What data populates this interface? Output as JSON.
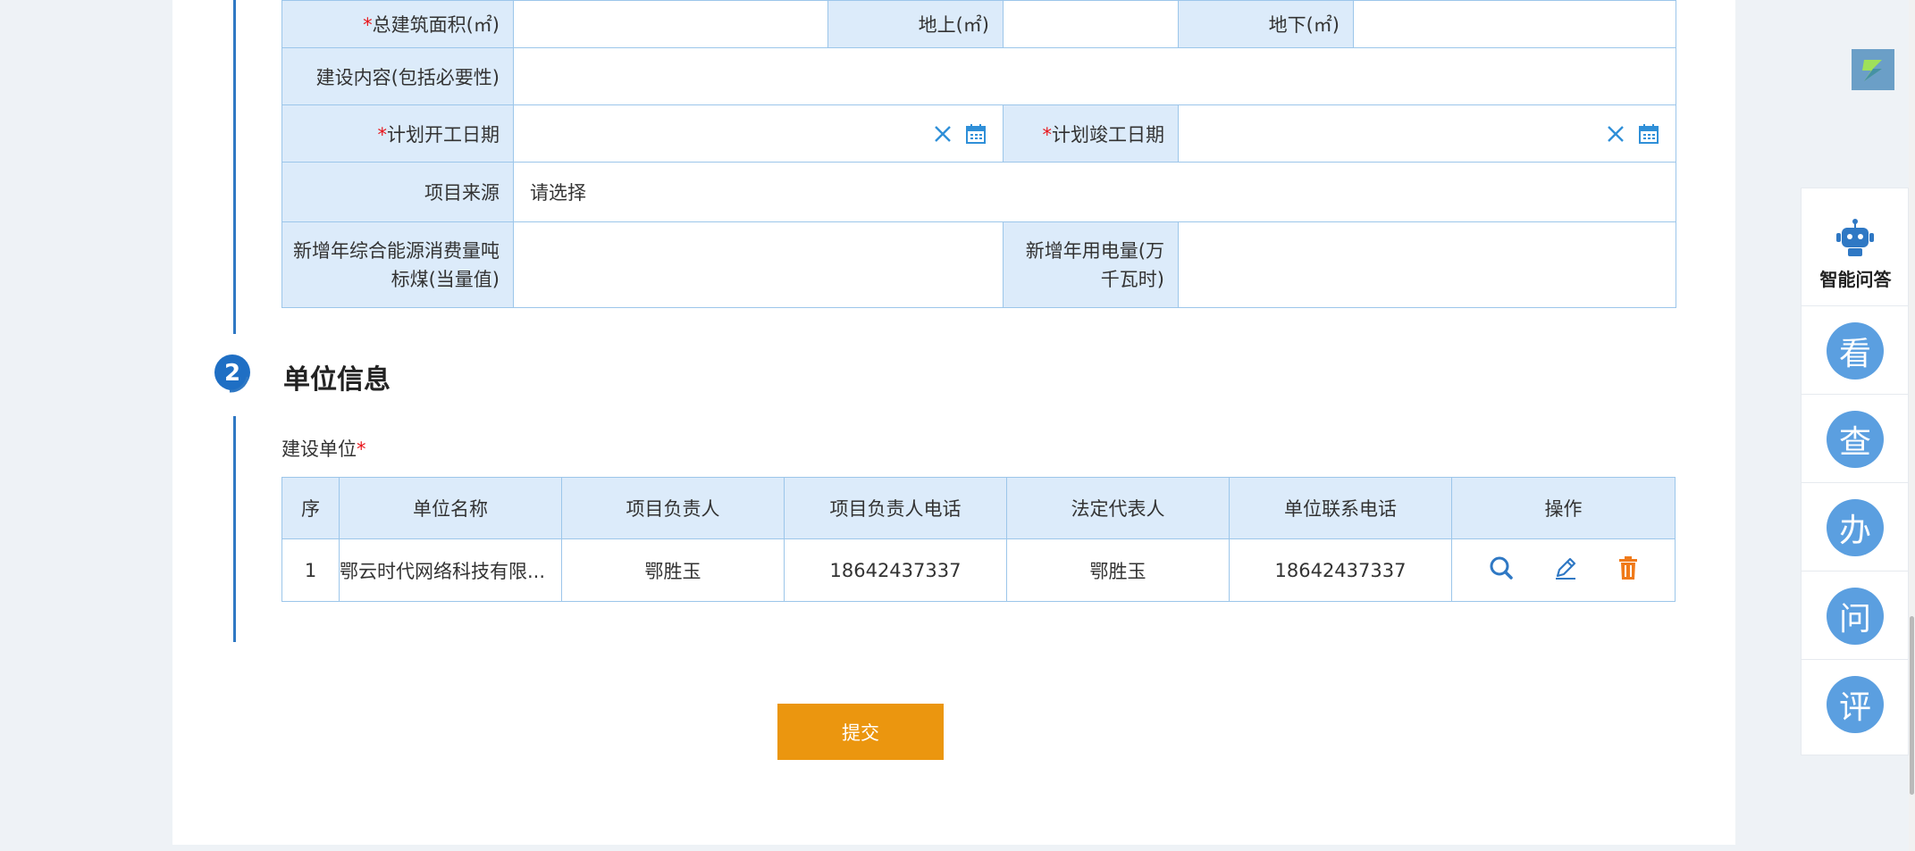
{
  "form": {
    "total_area_label": "总建筑面积(㎡)",
    "above_ground_label": "地上(㎡)",
    "below_ground_label": "地下(㎡)",
    "content_label": "建设内容(包括必要性)",
    "start_date_label": "计划开工日期",
    "finish_date_label": "计划竣工日期",
    "source_label": "项目来源",
    "source_value": "请选择",
    "energy_label": "新增年综合能源消费量吨标煤(当量值)",
    "power_label": "新增年用电量(万千瓦时)",
    "required_mark": "*"
  },
  "section2": {
    "number": "2",
    "title": "单位信息",
    "sub_label": "建设单位",
    "required_mark": "*"
  },
  "unit_table": {
    "headers": [
      "序",
      "单位名称",
      "项目负责人",
      "项目负责人电话",
      "法定代表人",
      "单位联系电话",
      "操作"
    ],
    "rows": [
      {
        "index": "1",
        "name": "鄂云时代网络科技有限...",
        "leader": "鄂胜玉",
        "leader_phone": "18642437337",
        "legal_rep": "鄂胜玉",
        "phone": "18642437337"
      }
    ]
  },
  "submit_label": "提交",
  "sidebar": {
    "robot_label": "智能问答",
    "items": [
      "看",
      "查",
      "办",
      "问",
      "评"
    ]
  },
  "colors": {
    "accent_blue": "#2f78c4",
    "label_bg": "#dcebfa",
    "submit_orange": "#eb960f",
    "delete_orange": "#f07a1a",
    "circle_blue": "#5b9fe0"
  }
}
